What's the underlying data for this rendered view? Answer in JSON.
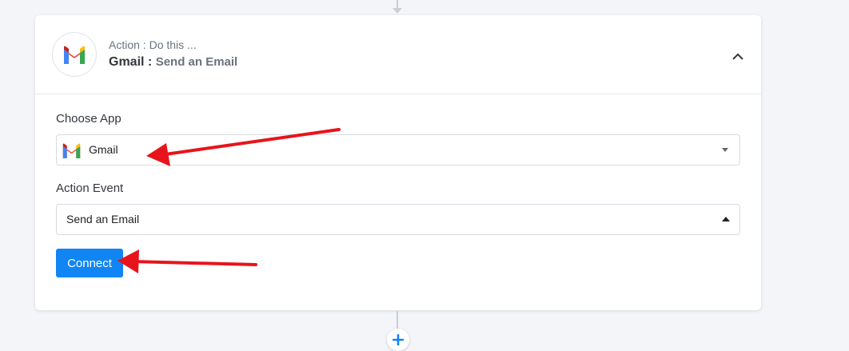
{
  "step": {
    "subtitle": "Action : Do this ...",
    "app_name": "Gmail :",
    "event_name": "Send an Email",
    "logo_icon": "gmail-logo",
    "collapse_icon": "chevron-up-icon"
  },
  "form": {
    "choose_app": {
      "label": "Choose App",
      "value": "Gmail",
      "icon": "gmail-logo"
    },
    "action_event": {
      "label": "Action Event",
      "value": "Send an Email"
    },
    "connect_button": "Connect"
  },
  "colors": {
    "primary": "#1185f4",
    "annotation_arrow": "#e8141b",
    "background": "#f3f5f8"
  },
  "add_step_icon": "plus-icon"
}
